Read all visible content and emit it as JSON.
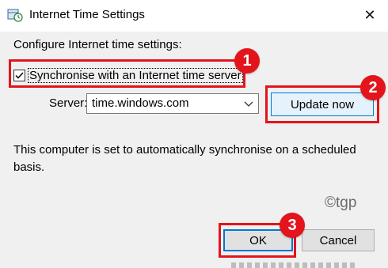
{
  "window": {
    "title": "Internet Time Settings",
    "close_glyph": "✕",
    "icon": "clock-globe-icon"
  },
  "dialog": {
    "intro": "Configure Internet time settings:",
    "sync_checkbox": {
      "label": "Synchronise with an Internet time server",
      "checked": true
    },
    "server": {
      "label": "Server:",
      "value": "time.windows.com"
    },
    "update_button": "Update now",
    "info": "This computer is set to automatically synchronise on a scheduled basis.",
    "ok_button": "OK",
    "cancel_button": "Cancel"
  },
  "annotations": {
    "badges": [
      "1",
      "2",
      "3"
    ],
    "color": "#e3141b",
    "watermark": "©tgp"
  },
  "colors": {
    "focus_blue": "#0078d7",
    "update_bg": "#e5f1fb",
    "dialog_bg": "#f0f0f0"
  }
}
